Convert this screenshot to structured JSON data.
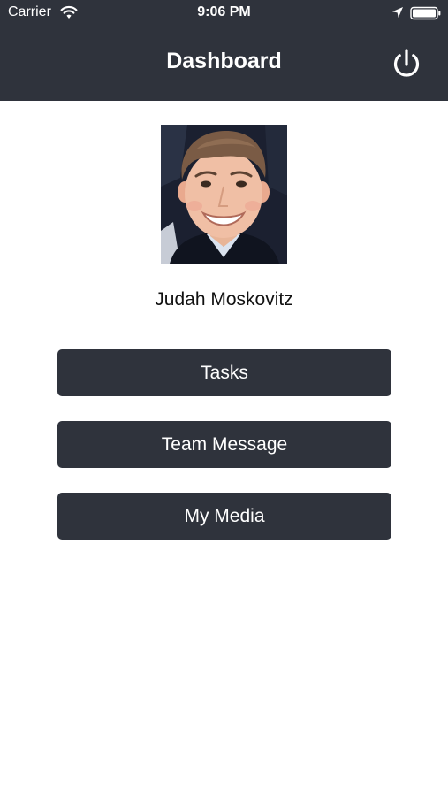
{
  "status_bar": {
    "carrier": "Carrier",
    "time": "9:06 PM",
    "icons": [
      "wifi-icon",
      "location-icon",
      "battery-icon"
    ]
  },
  "nav": {
    "title": "Dashboard",
    "action_icon": "power-icon"
  },
  "profile": {
    "name": "Judah Moskovitz"
  },
  "menu": {
    "tasks": "Tasks",
    "team_message": "Team Message",
    "my_media": "My Media"
  },
  "colors": {
    "header_bg": "#2f333c",
    "button_bg": "#2f333c",
    "page_bg": "#ffffff",
    "text_on_dark": "#ffffff",
    "text_dark": "#111111"
  }
}
